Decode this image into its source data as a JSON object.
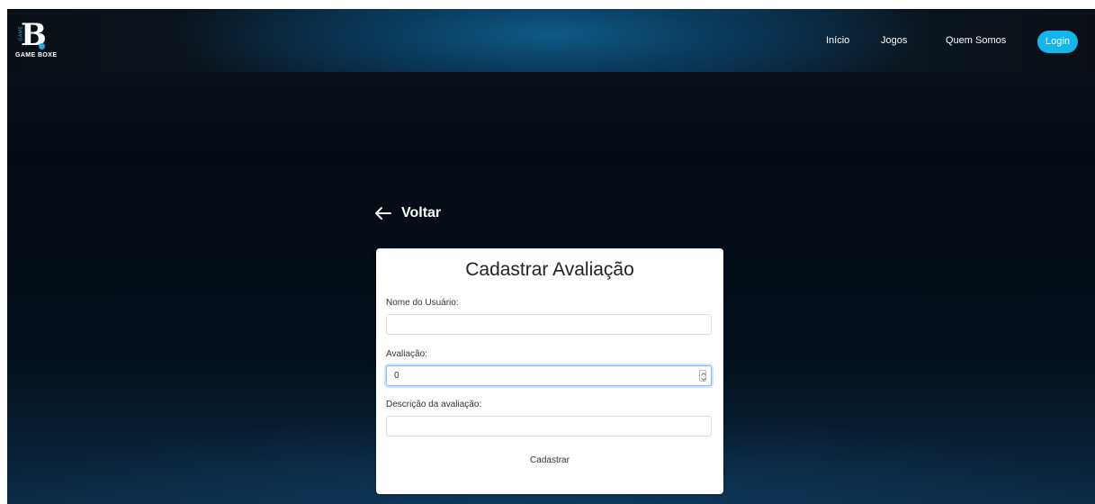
{
  "brand": {
    "logo_letter": "B",
    "logo_vertical_text": "GAME",
    "logo_text": "GAME BOXE"
  },
  "nav": {
    "links": [
      "Início",
      "Jogos",
      "Quem Somos"
    ],
    "login_label": "Login"
  },
  "back": {
    "label": "Voltar",
    "icon": "arrow-left-icon"
  },
  "form": {
    "title": "Cadastrar Avaliação",
    "fields": [
      {
        "label": "Nome do Usuário:",
        "value": ""
      },
      {
        "label": "Avaliação:",
        "value": "0"
      },
      {
        "label": "Descrição da avaliação:",
        "value": ""
      }
    ],
    "submit_label": "Cadastrar"
  },
  "colors": {
    "accent": "#13b5ec",
    "background_dark": "#040b14",
    "card": "#ffffff"
  }
}
